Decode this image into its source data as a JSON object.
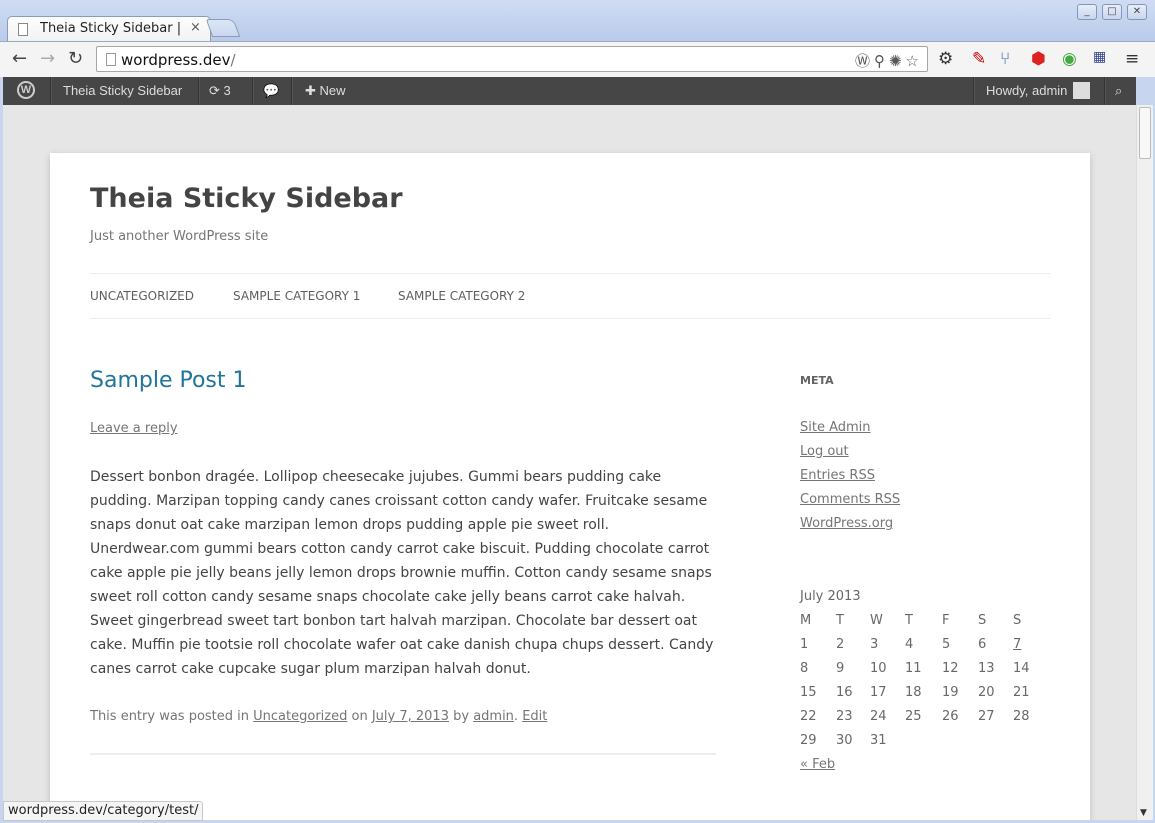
{
  "browser": {
    "tab_title": "Theia Sticky Sidebar | ",
    "tab_close": "×",
    "url_host": "wordpress.dev",
    "url_path": "/",
    "icons": [
      "back-icon",
      "forward-icon",
      "reload-icon",
      "wordpress-icon",
      "star-icon",
      "gear-icon",
      "menu-icon"
    ],
    "status_url": "wordpress.dev/category/test/"
  },
  "adminbar": {
    "site_name": "Theia Sticky Sidebar",
    "updates_count": "3",
    "new_label": "New",
    "howdy": "Howdy, admin"
  },
  "site": {
    "title": "Theia Sticky Sidebar",
    "description": "Just another WordPress site",
    "menu": [
      "UNCATEGORIZED",
      "SAMPLE CATEGORY 1",
      "SAMPLE CATEGORY 2"
    ]
  },
  "post": {
    "title": "Sample Post 1",
    "leave_reply": "Leave a reply",
    "content": "Dessert bonbon dragée. Lollipop cheesecake jujubes. Gummi bears pudding cake pudding. Marzipan topping candy canes croissant cotton candy wafer. Fruitcake sesame snaps donut oat cake marzipan lemon drops pudding apple pie sweet roll. Unerdwear.com gummi bears cotton candy carrot cake biscuit. Pudding chocolate carrot cake apple pie jelly beans jelly lemon drops brownie muffin. Cotton candy sesame snaps sweet roll cotton candy sesame snaps chocolate cake jelly beans carrot cake halvah. Sweet gingerbread sweet tart bonbon tart halvah marzipan. Chocolate bar dessert oat cake. Muffin pie tootsie roll chocolate wafer oat cake danish chupa chups dessert. Candy canes carrot cake cupcake sugar plum marzipan halvah donut.",
    "meta_prefix": "This entry was posted in ",
    "meta_category": "Uncategorized",
    "meta_on": " on ",
    "meta_date": "July 7, 2013",
    "meta_by": " by ",
    "meta_author": "admin",
    "meta_dot": ". ",
    "meta_edit": "Edit"
  },
  "sidebar": {
    "meta_heading": "META",
    "links": [
      "Site Admin",
      "Log out",
      "Entries RSS",
      "Comments RSS",
      "WordPress.org"
    ],
    "calendar": {
      "caption": "July 2013",
      "headers": [
        "M",
        "T",
        "W",
        "T",
        "F",
        "S",
        "S"
      ],
      "rows": [
        [
          "1",
          "2",
          "3",
          "4",
          "5",
          "6",
          "7"
        ],
        [
          "8",
          "9",
          "10",
          "11",
          "12",
          "13",
          "14"
        ],
        [
          "15",
          "16",
          "17",
          "18",
          "19",
          "20",
          "21"
        ],
        [
          "22",
          "23",
          "24",
          "25",
          "26",
          "27",
          "28"
        ],
        [
          "29",
          "30",
          "31",
          "",
          "",
          "",
          ""
        ]
      ],
      "linked_day": "7",
      "prev": "« Feb"
    }
  }
}
